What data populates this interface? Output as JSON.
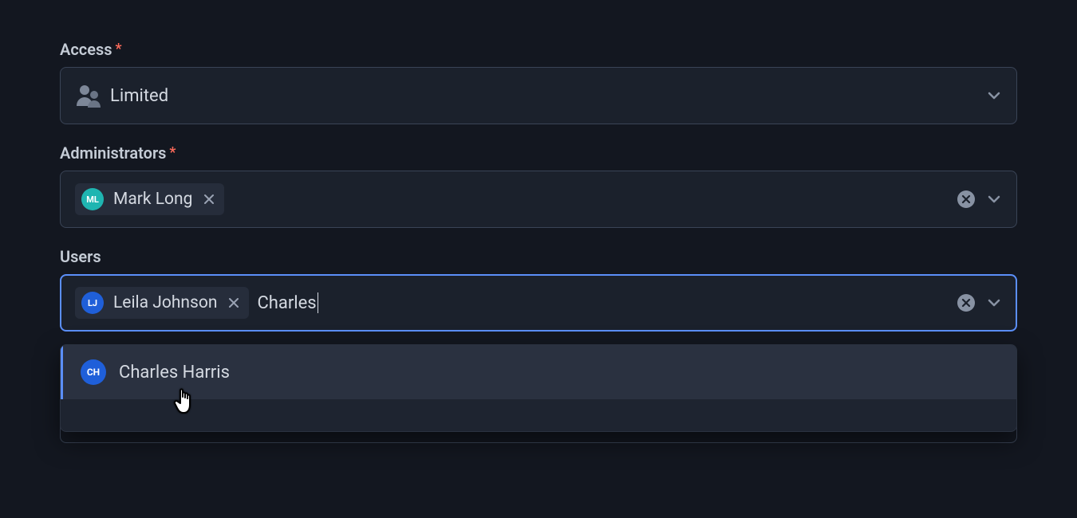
{
  "access": {
    "label": "Access",
    "required_marker": "*",
    "value": "Limited"
  },
  "administrators": {
    "label": "Administrators",
    "required_marker": "*",
    "chips": [
      {
        "initials": "ML",
        "name": "Mark Long",
        "avatar_color": "teal"
      }
    ]
  },
  "users": {
    "label": "Users",
    "chips": [
      {
        "initials": "LJ",
        "name": "Leila Johnson",
        "avatar_color": "blue"
      }
    ],
    "input_value": "Charles",
    "dropdown": [
      {
        "initials": "CH",
        "name": "Charles Harris",
        "avatar_color": "blue"
      }
    ]
  }
}
